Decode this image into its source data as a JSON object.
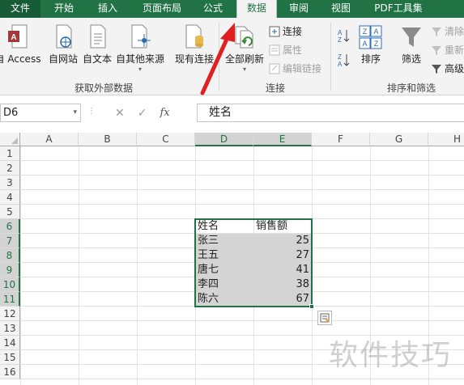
{
  "tabs": [
    "文件",
    "开始",
    "插入",
    "页面布局",
    "公式",
    "数据",
    "审阅",
    "视图",
    "PDF工具集"
  ],
  "active_tab": "数据",
  "ribbon": {
    "external_data": {
      "group_label": "获取外部数据",
      "from_access": "自 Access",
      "from_web": "自网站",
      "from_text": "自文本",
      "from_other": "自其他来源",
      "existing_connections": "现有连接"
    },
    "connections": {
      "group_label": "连接",
      "refresh_all": "全部刷新",
      "connections": "连接",
      "properties": "属性",
      "edit_links": "编辑链接"
    },
    "sort_filter": {
      "group_label": "排序和筛选",
      "sort": "排序",
      "filter": "筛选",
      "clear": "清除",
      "reapply": "重新",
      "advanced": "高级"
    }
  },
  "formula_bar": {
    "name_box": "D6",
    "fx": "fx",
    "cancel": "✕",
    "enter": "✓",
    "content": "姓名"
  },
  "columns": [
    "A",
    "B",
    "C",
    "D",
    "E",
    "F",
    "G",
    "H"
  ],
  "rows": [
    "1",
    "2",
    "3",
    "4",
    "5",
    "6",
    "7",
    "8",
    "9",
    "10",
    "11",
    "12",
    "13",
    "14",
    "15",
    "16"
  ],
  "table": {
    "header": [
      "姓名",
      "销售额"
    ],
    "rows": [
      [
        "张三",
        "25"
      ],
      [
        "王五",
        "27"
      ],
      [
        "唐七",
        "41"
      ],
      [
        "李四",
        "38"
      ],
      [
        "陈六",
        "67"
      ]
    ]
  },
  "watermark": "软件技巧",
  "colors": {
    "excel_green": "#217346",
    "arrow": "#e02020"
  }
}
